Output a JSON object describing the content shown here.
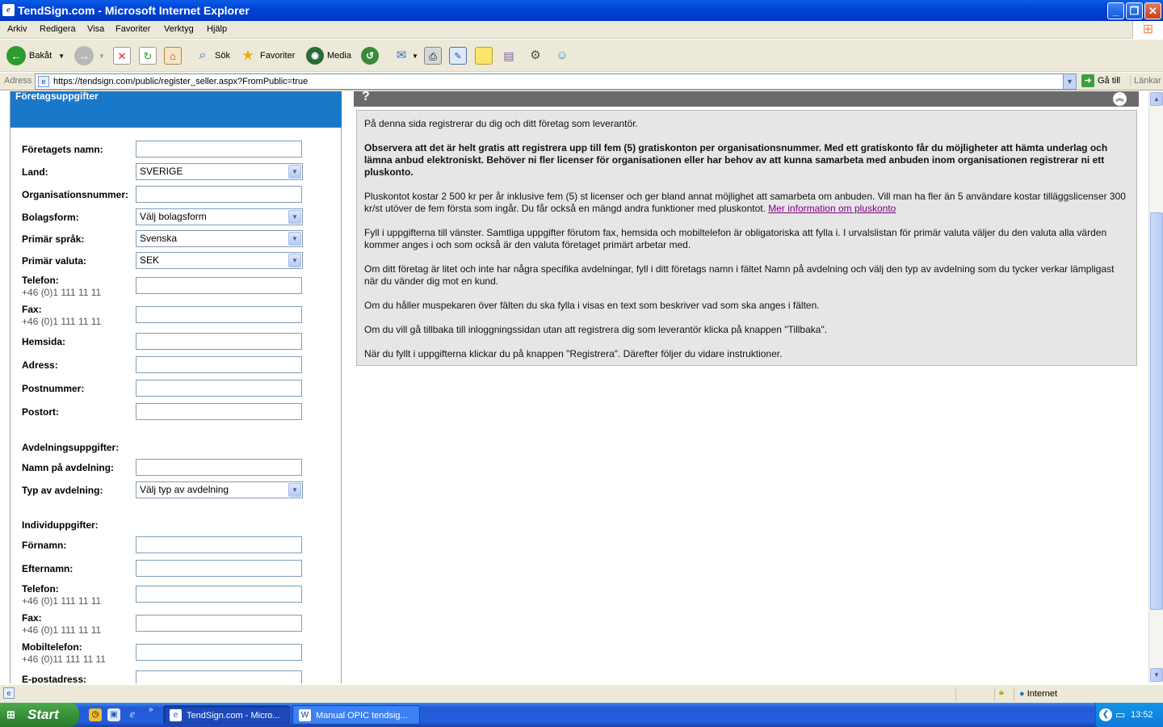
{
  "window": {
    "title": "TendSign.com - Microsoft Internet Explorer"
  },
  "menu": [
    "Arkiv",
    "Redigera",
    "Visa",
    "Favoriter",
    "Verktyg",
    "Hjälp"
  ],
  "toolbar": {
    "back": "Bakåt",
    "search": "Sök",
    "favorites": "Favoriter",
    "media": "Media"
  },
  "address": {
    "label": "Adress",
    "url": "https://tendsign.com/public/register_seller.aspx?FromPublic=true",
    "go": "Gå till",
    "links": "Länkar"
  },
  "form": {
    "header": "Företagsuppgifter",
    "company_name": "Företagets namn:",
    "country": "Land:",
    "country_value": "SVERIGE",
    "org_number": "Organisationsnummer:",
    "company_type": "Bolagsform:",
    "company_type_value": "Välj bolagsform",
    "language": "Primär språk:",
    "language_value": "Svenska",
    "currency": "Primär valuta:",
    "currency_value": "SEK",
    "phone": "Telefon:",
    "phone_hint": "+46 (0)1 111 11 11",
    "fax": "Fax:",
    "fax_hint": "+46 (0)1 111 11 11",
    "website": "Hemsida:",
    "address": "Adress:",
    "zip": "Postnummer:",
    "city": "Postort:",
    "dept_section": "Avdelningsuppgifter:",
    "dept_name": "Namn på avdelning:",
    "dept_type": "Typ av avdelning:",
    "dept_type_value": "Välj typ av avdelning",
    "indiv_section": "Individuppgifter:",
    "first_name": "Förnamn:",
    "last_name": "Efternamn:",
    "indiv_phone": "Telefon:",
    "indiv_phone_hint": "+46 (0)1 111 11 11",
    "indiv_fax": "Fax:",
    "indiv_fax_hint": "+46 (0)1 111 11 11",
    "mobile": "Mobiltelefon:",
    "mobile_hint": "+46 (0)11 111 11 11",
    "email": "E-postadress:"
  },
  "info": {
    "p1": "På denna sida registrerar du dig och ditt företag som leverantör.",
    "p2": "Observera att det är helt gratis att registrera upp till fem (5) gratiskonton per organisationsnummer. Med ett gratiskonto får du möjligheter att hämta underlag och lämna anbud elektroniskt. Behöver ni fler licenser för organisationen eller har behov av att kunna samarbeta med anbuden inom organisationen registrerar ni ett pluskonto.",
    "p3": "Pluskontot kostar 2 500 kr per år inklusive fem (5) st licenser och ger bland annat möjlighet att samarbeta om anbuden. Vill man ha fler än 5 användare kostar tilläggslicenser 300 kr/st utöver de fem första som ingår. Du får också en mängd andra funktioner med pluskontot.",
    "p3_link": "Mer information om pluskonto",
    "p4": "Fyll i uppgifterna till vänster. Samtliga uppgifter förutom fax, hemsida och mobiltelefon är obligatoriska att fylla i. I urvalslistan för primär valuta väljer du den valuta alla värden kommer anges i och som också är den valuta företaget primärt arbetar med.",
    "p5": "Om ditt företag är litet och inte har några specifika avdelningar, fyll i ditt företags namn i fältet Namn på avdelning och välj den typ av avdelning som du tycker verkar lämpligast när du vänder dig mot en kund.",
    "p6": "Om du håller muspekaren över fälten du ska fylla i visas en text som beskriver vad som ska anges i fälten.",
    "p7": "Om du vill gå tillbaka till inloggningssidan utan att registrera dig som leverantör klicka på knappen \"Tillbaka\".",
    "p8": "När du fyllt i uppgifterna klickar du på knappen \"Registrera\". Därefter följer du vidare instruktioner."
  },
  "status": {
    "zone": "Internet"
  },
  "taskbar": {
    "start": "Start",
    "task1": "TendSign.com - Micro...",
    "task2": "Manual OPIC tendsig...",
    "clock": "13:52"
  }
}
